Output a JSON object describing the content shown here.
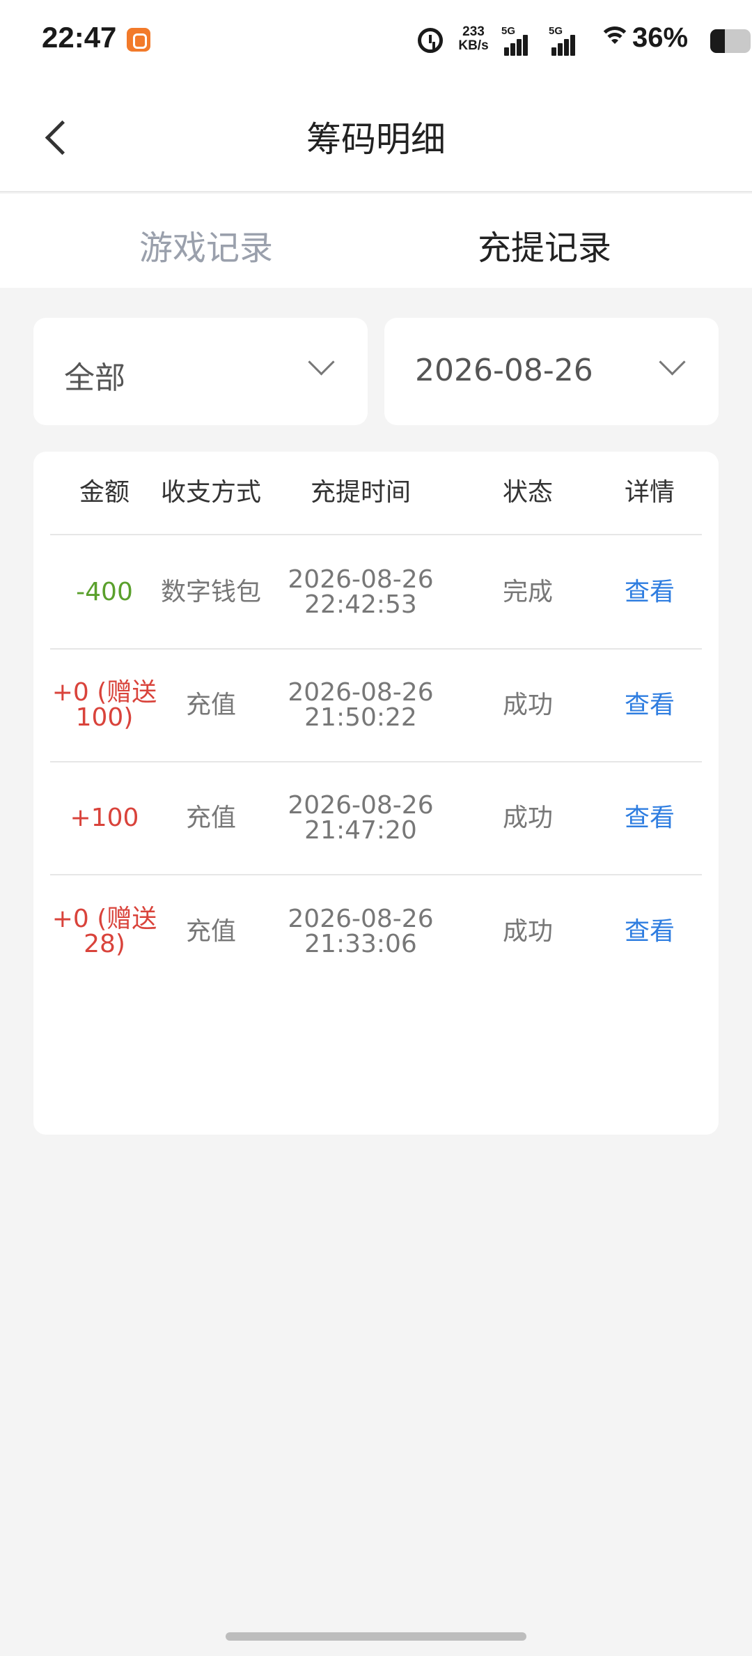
{
  "status_bar": {
    "time": "22:47",
    "speed_value": "233",
    "speed_unit": "KB/s",
    "network1": "5G",
    "network2": "5G",
    "battery": "36%",
    "battery_level": 0.36
  },
  "header": {
    "title": "筹码明细"
  },
  "tabs": [
    {
      "label": "游戏记录",
      "active": false
    },
    {
      "label": "充提记录",
      "active": true
    }
  ],
  "filters": {
    "type": "全部",
    "date": "2026-08-26"
  },
  "table": {
    "columns": [
      "金额",
      "收支方式",
      "充提时间",
      "状态",
      "详情"
    ],
    "rows": [
      {
        "amount": "-400",
        "method": "数字钱包",
        "date": "2026-08-26",
        "time": "22:42:53",
        "status": "完成",
        "detail": "查看"
      },
      {
        "amount": "+0 (赠送\n100)",
        "method": "充值",
        "date": "2026-08-26",
        "time": "21:50:22",
        "status": "成功",
        "detail": "查看"
      },
      {
        "amount": "+100",
        "method": "充值",
        "date": "2026-08-26",
        "time": "21:47:20",
        "status": "成功",
        "detail": "查看"
      },
      {
        "amount": "+0 (赠送\n28)",
        "method": "充值",
        "date": "2026-08-26",
        "time": "21:33:06",
        "status": "成功",
        "detail": "查看"
      }
    ]
  },
  "colors": {
    "negative": "#5aa02c",
    "positive": "#d9433b",
    "link": "#2e7de0"
  }
}
